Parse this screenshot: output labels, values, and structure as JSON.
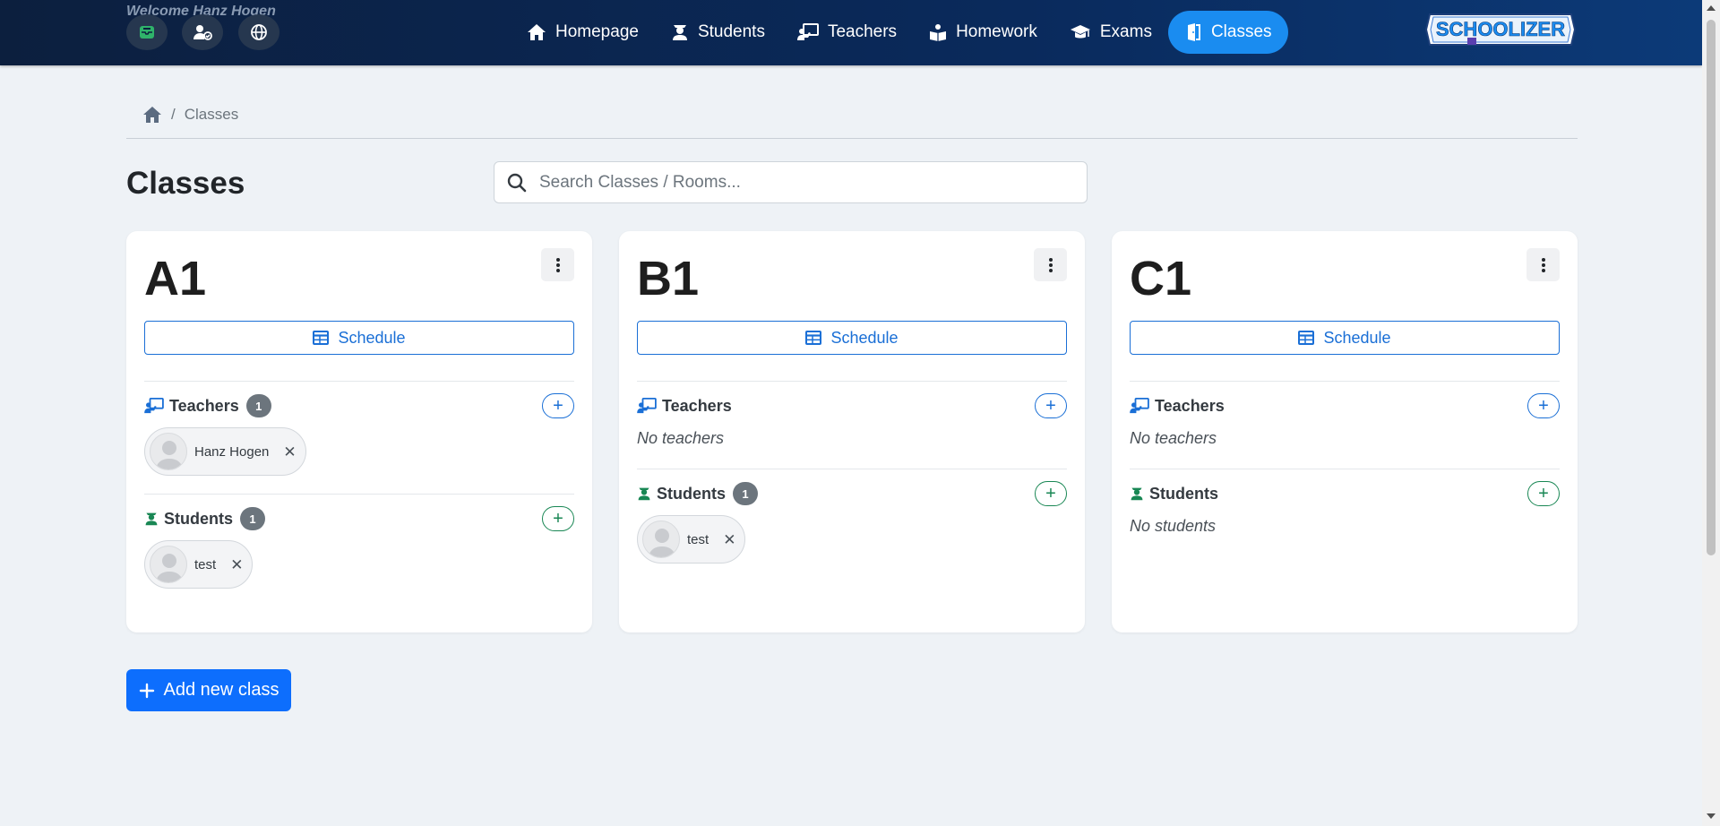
{
  "header": {
    "welcome": "Welcome Hanz Hogen",
    "logo_text": "SCHOOLIZER",
    "quick_icons": [
      "inbox-icon",
      "user-check-icon",
      "globe-icon"
    ],
    "nav": [
      {
        "label": "Homepage",
        "icon": "home-icon"
      },
      {
        "label": "Students",
        "icon": "student-icon"
      },
      {
        "label": "Teachers",
        "icon": "teacher-icon"
      },
      {
        "label": "Homework",
        "icon": "reading-icon"
      },
      {
        "label": "Exams",
        "icon": "graduation-cap-icon"
      },
      {
        "label": "Classes",
        "icon": "door-icon",
        "active": true
      }
    ]
  },
  "breadcrumb": {
    "current": "Classes"
  },
  "page": {
    "title": "Classes",
    "search_placeholder": "Search Classes / Rooms...",
    "add_class_label": "Add new class"
  },
  "classes": [
    {
      "name": "A1",
      "schedule_label": "Schedule",
      "teachers_label": "Teachers",
      "teachers_count": "1",
      "teachers": [
        "Hanz Hogen"
      ],
      "students_label": "Students",
      "students_count": "1",
      "students": [
        "test"
      ]
    },
    {
      "name": "B1",
      "schedule_label": "Schedule",
      "teachers_label": "Teachers",
      "teachers_empty": "No teachers",
      "students_label": "Students",
      "students_count": "1",
      "students": [
        "test"
      ]
    },
    {
      "name": "C1",
      "schedule_label": "Schedule",
      "teachers_label": "Teachers",
      "teachers_empty": "No teachers",
      "students_label": "Students",
      "students_empty": "No students"
    }
  ],
  "colors": {
    "primary": "#0d6efd",
    "active_nav": "#1a8cf0",
    "teacher_icon": "#1a6fd6",
    "student_icon": "#198754",
    "navbar": "#0a2a5c"
  }
}
